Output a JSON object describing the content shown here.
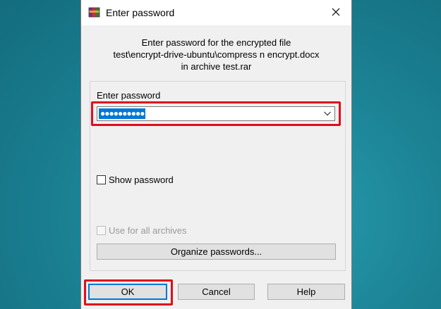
{
  "dialog": {
    "title": "Enter password",
    "app_icon": "winrar-icon",
    "close_icon": "close-icon",
    "info_lines": [
      "Enter password for the encrypted file",
      "test\\encrypt-drive-ubuntu\\compress n encrypt.docx",
      "in archive test.rar"
    ],
    "password": {
      "label": "Enter password",
      "value": "●●●●●●●●●●",
      "dropdown_icon": "chevron-down-icon"
    },
    "show_password_label": "Show password",
    "use_for_all_label": "Use for all archives",
    "organize_label": "Organize passwords...",
    "buttons": {
      "ok": "OK",
      "cancel": "Cancel",
      "help": "Help"
    },
    "highlight_color": "#e00d1c",
    "accent_color": "#0078d7"
  }
}
